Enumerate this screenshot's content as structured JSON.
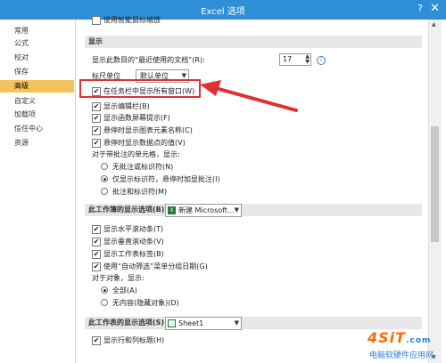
{
  "window": {
    "title": "Excel 选项",
    "help": "?",
    "close": "✕"
  },
  "sidebar": {
    "items": [
      {
        "label": "常用"
      },
      {
        "label": "公式"
      },
      {
        "label": "校对"
      },
      {
        "label": "保存"
      },
      {
        "label": "高级",
        "selected": true
      },
      {
        "label": "自定义"
      },
      {
        "label": "加载项"
      },
      {
        "label": "信任中心"
      },
      {
        "label": "资源"
      }
    ]
  },
  "top_cut_label": "使用智能鼠标缩放",
  "display": {
    "heading": "显示",
    "recent_label": "显示此数目的“最近使用的文档”(R):",
    "recent_value": "17",
    "ruler_label": "标尺单位",
    "ruler_value": "默认单位",
    "options": [
      {
        "label": "在任务栏中显示所有窗口(W)",
        "checked": true
      },
      {
        "label": "显示编辑栏(B)",
        "checked": true
      },
      {
        "label": "显示函数屏幕提示(F)",
        "checked": true
      },
      {
        "label": "悬停时显示图表元素名称(C)",
        "checked": true
      },
      {
        "label": "悬停时显示数据点的值(V)",
        "checked": true
      }
    ],
    "comments_label": "对于带批注的单元格，显示:",
    "comments_options": [
      {
        "label": "无批注或标识符(N)",
        "selected": false
      },
      {
        "label": "仅显示标识符，悬停时加显批注(I)",
        "selected": true
      },
      {
        "label": "批注和标识符(M)",
        "selected": false
      }
    ]
  },
  "workbook": {
    "heading": "此工作簿的显示选项(B):",
    "selector": "新建 Microsoft...",
    "options": [
      {
        "label": "显示水平滚动条(T)",
        "checked": true
      },
      {
        "label": "显示垂直滚动条(V)",
        "checked": true
      },
      {
        "label": "显示工作表标签(B)",
        "checked": true
      },
      {
        "label": "使用“自动筛选”菜单分组日期(G)",
        "checked": true
      }
    ],
    "objects_label": "对于对象，显示:",
    "objects_options": [
      {
        "label": "全部(A)",
        "selected": true
      },
      {
        "label": "无内容(隐藏对象)(D)",
        "selected": false
      }
    ]
  },
  "worksheet": {
    "heading": "此工作表的显示选项(S):",
    "selector": "Sheet1",
    "bottom_cut_label": "显示行和列标题(H)"
  },
  "watermark": {
    "brand": "4SiT",
    "domain": ".com",
    "subtitle": "电脑软硬件应用网"
  },
  "colors": {
    "titlebar": "#2f8ed8",
    "selected_nav": "#f5c35b",
    "annotation": "#e03030"
  }
}
